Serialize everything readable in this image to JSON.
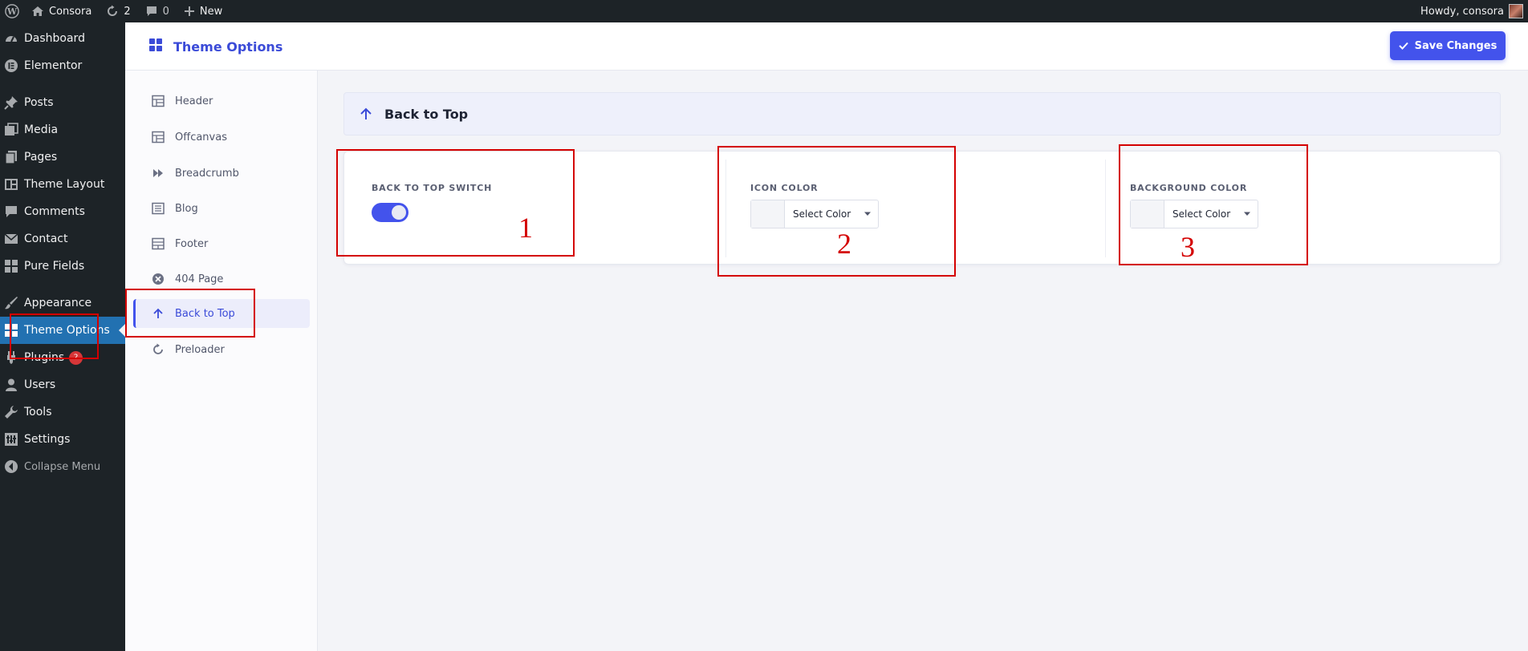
{
  "adminbar": {
    "site_name": "Consora",
    "updates_count": "2",
    "comments_count": "0",
    "new_label": "New",
    "greeting": "Howdy, consora"
  },
  "menu": {
    "items": [
      {
        "label": "Dashboard",
        "icon": "dashboard-icon"
      },
      {
        "label": "Elementor",
        "icon": "elementor-icon"
      },
      {
        "label": "Posts",
        "icon": "pushpin-icon"
      },
      {
        "label": "Media",
        "icon": "media-icon"
      },
      {
        "label": "Pages",
        "icon": "pages-icon"
      },
      {
        "label": "Theme Layout",
        "icon": "layout-icon"
      },
      {
        "label": "Comments",
        "icon": "comment-icon"
      },
      {
        "label": "Contact",
        "icon": "mail-icon"
      },
      {
        "label": "Pure Fields",
        "icon": "grid-icon"
      },
      {
        "label": "Appearance",
        "icon": "brush-icon"
      },
      {
        "label": "Theme Options",
        "icon": "grid-icon",
        "active": true
      },
      {
        "label": "Plugins",
        "icon": "plugin-icon",
        "badge": "2"
      },
      {
        "label": "Users",
        "icon": "user-icon"
      },
      {
        "label": "Tools",
        "icon": "wrench-icon"
      },
      {
        "label": "Settings",
        "icon": "settings-icon"
      }
    ],
    "collapse_label": "Collapse Menu"
  },
  "theme_options": {
    "title": "Theme Options",
    "save_label": "Save Changes"
  },
  "sidebar": {
    "items": [
      {
        "label": "Header",
        "icon": "layout-icon"
      },
      {
        "label": "Offcanvas",
        "icon": "layout-icon"
      },
      {
        "label": "Breadcrumb",
        "icon": "fast-forward-icon"
      },
      {
        "label": "Blog",
        "icon": "list-icon"
      },
      {
        "label": "Footer",
        "icon": "layout-icon"
      },
      {
        "label": "404 Page",
        "icon": "close-circle-icon"
      },
      {
        "label": "Back to Top",
        "icon": "arrow-up-icon",
        "active": true
      },
      {
        "label": "Preloader",
        "icon": "refresh-icon"
      }
    ]
  },
  "section": {
    "title": "Back to Top"
  },
  "options": {
    "switch_label": "BACK TO TOP SWITCH",
    "switch_on": true,
    "icon_color_label": "ICON COLOR",
    "icon_color_select": "Select Color",
    "bg_color_label": "BACKGROUND COLOR",
    "bg_color_select": "Select Color"
  },
  "annotations": [
    "1",
    "2",
    "3"
  ],
  "colors": {
    "accent": "#4353ec",
    "wp_dark": "#1d2327",
    "wp_active": "#2271b1",
    "annotation": "#d40000"
  }
}
